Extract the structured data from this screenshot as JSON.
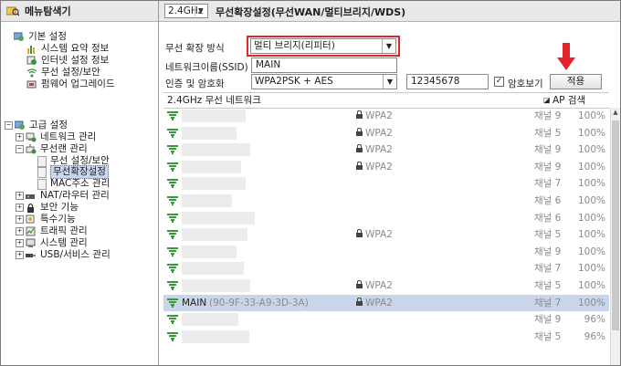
{
  "sidebar": {
    "title": "메뉴탐색기",
    "basic_group": "기본 설정",
    "basic_items": [
      "시스템 요약 정보",
      "인터넷 설정 정보",
      "무선 설정/보안",
      "펌웨어 업그레이드"
    ],
    "advanced_group": "고급 설정",
    "adv_items": {
      "network": "네트워크 관리",
      "wireless": "무선랜 관리",
      "wireless_sub": [
        "무선 설정/보안",
        "무선확장설정",
        "MAC주소 관리"
      ],
      "nat": "NAT/라우터 관리",
      "security": "보안 기능",
      "special": "특수기능",
      "traffic": "트래픽 관리",
      "system": "시스템 관리",
      "usb": "USB/서비스 관리"
    }
  },
  "header": {
    "band": "2.4GHz",
    "title": "무선확장설정(무선WAN/멀티브리지/WDS)"
  },
  "form": {
    "mode_label": "무선 확장 방식",
    "mode_value": "멀티 브리지(리피터)",
    "ssid_label": "네트워크이름(SSID)",
    "ssid_value": "MAIN",
    "auth_label": "인증 및 암호화",
    "auth_value": "WPA2PSK + AES",
    "password_value": "12345678",
    "show_password_label": "암호보기",
    "show_password_checked": "✓",
    "apply_label": "적용"
  },
  "list": {
    "header": "2.4GHz 무선 네트워크",
    "ap_scan": "AP 검색",
    "rows": [
      {
        "name": "",
        "mac": "",
        "sec": "WPA2",
        "channel": "채널 9",
        "signal": "100%"
      },
      {
        "name": "",
        "mac": "",
        "sec": "WPA2",
        "channel": "채널 5",
        "signal": "100%"
      },
      {
        "name": "",
        "mac": "",
        "sec": "WPA2",
        "channel": "채널 9",
        "signal": "100%"
      },
      {
        "name": "",
        "mac": "",
        "sec": "WPA2",
        "channel": "채널 9",
        "signal": "100%"
      },
      {
        "name": "",
        "mac": "",
        "sec": "",
        "channel": "채널 7",
        "signal": "100%"
      },
      {
        "name": "",
        "mac": "",
        "sec": "",
        "channel": "채널 6",
        "signal": "100%"
      },
      {
        "name": "",
        "mac": "",
        "sec": "",
        "channel": "채널 6",
        "signal": "100%"
      },
      {
        "name": "",
        "mac": "",
        "sec": "WPA2",
        "channel": "채널 5",
        "signal": "100%"
      },
      {
        "name": "",
        "mac": "",
        "sec": "",
        "channel": "채널 9",
        "signal": "100%"
      },
      {
        "name": "",
        "mac": "",
        "sec": "",
        "channel": "채널 7",
        "signal": "100%"
      },
      {
        "name": "",
        "mac": "",
        "sec": "WPA2",
        "channel": "채널 5",
        "signal": "100%"
      },
      {
        "name": "MAIN",
        "mac": "(90-9F-33-A9-3D-3A)",
        "sec": "WPA2",
        "channel": "채널 7",
        "signal": "100%"
      },
      {
        "name": "",
        "mac": "",
        "sec": "",
        "channel": "채널 9",
        "signal": "96%"
      },
      {
        "name": "",
        "mac": "",
        "sec": "",
        "channel": "채널 5",
        "signal": "96%"
      }
    ]
  },
  "colors": {
    "highlight_outline": "#e0262b",
    "selected_row": "#c9d6ea",
    "wifi_icon": "#3a9a3a"
  }
}
